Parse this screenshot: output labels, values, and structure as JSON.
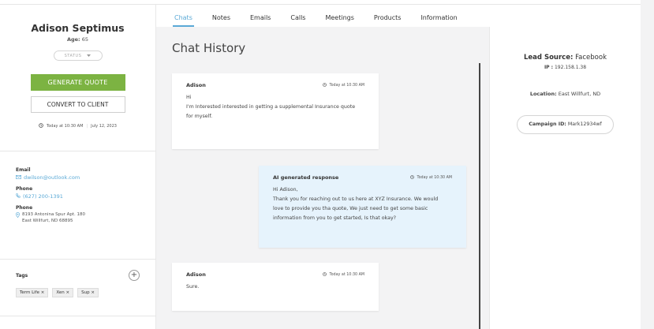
{
  "profile": {
    "name": "Adison Septimus",
    "age_label": "Age:",
    "age_value": "65",
    "status_placeholder": "STATUS",
    "generate_quote": "GENERATE QUOTE",
    "convert_to_client": "CONVERT TO CLIENT",
    "time": "Today at 10:30 AM",
    "date": "July 12, 2023"
  },
  "contact": {
    "email_label": "Email",
    "email": "dwilson@outlook.com",
    "phone_label": "Phone",
    "phone": "(627) 200-1391",
    "address_label": "Phone",
    "address_line1": "8193 Antonina Spur Apt. 180",
    "address_line2": "East Willfurt, ND 68895"
  },
  "tags": {
    "title": "Tags",
    "items": [
      "Term Life ×",
      "Xen ×",
      "Sup ×"
    ]
  },
  "tabs": [
    "Chats",
    "Notes",
    "Emails",
    "Calls",
    "Meetings",
    "Products",
    "Information"
  ],
  "chat": {
    "title": "Chat History",
    "messages": [
      {
        "sender": "Adison",
        "time": "Today at 10:30 AM",
        "lines": [
          "Hi",
          "I'm Interested interested in getting a supplemental Insurance quote",
          "for myself."
        ]
      },
      {
        "sender": "AI generated response",
        "time": "Today at 10:30 AM",
        "lines": [
          "Hi Adison,",
          "Thank you for reaching out to us here at XYZ Insurance. We would",
          "love to provide you tha quote, We just need to get some basic",
          "information from you to get started, Is that okay?"
        ]
      },
      {
        "sender": "Adison",
        "time": "Today at 10:30 AM",
        "lines": [
          "Sure."
        ]
      }
    ]
  },
  "right": {
    "lead_label": "Lead Source:",
    "lead_value": "Facebook",
    "ip_label": "IP :",
    "ip_value": "192.158.1.38",
    "location_label": "Location:",
    "location_value": "East Willfurt, ND",
    "campaign_label": "Campaign ID:",
    "campaign_value": "Mark12934wf"
  },
  "colors": {
    "accent": "#5aa9d6",
    "green": "#7cb342",
    "ai_bg": "#e6f3fc"
  }
}
